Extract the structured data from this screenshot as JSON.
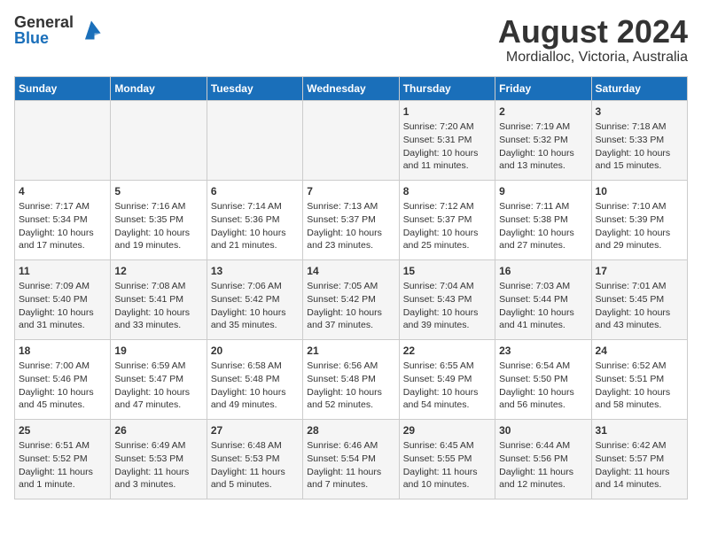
{
  "header": {
    "logo_general": "General",
    "logo_blue": "Blue",
    "title": "August 2024",
    "subtitle": "Mordialloc, Victoria, Australia"
  },
  "days_of_week": [
    "Sunday",
    "Monday",
    "Tuesday",
    "Wednesday",
    "Thursday",
    "Friday",
    "Saturday"
  ],
  "weeks": [
    [
      {
        "day": "",
        "content": ""
      },
      {
        "day": "",
        "content": ""
      },
      {
        "day": "",
        "content": ""
      },
      {
        "day": "",
        "content": ""
      },
      {
        "day": "1",
        "content": "Sunrise: 7:20 AM\nSunset: 5:31 PM\nDaylight: 10 hours\nand 11 minutes."
      },
      {
        "day": "2",
        "content": "Sunrise: 7:19 AM\nSunset: 5:32 PM\nDaylight: 10 hours\nand 13 minutes."
      },
      {
        "day": "3",
        "content": "Sunrise: 7:18 AM\nSunset: 5:33 PM\nDaylight: 10 hours\nand 15 minutes."
      }
    ],
    [
      {
        "day": "4",
        "content": "Sunrise: 7:17 AM\nSunset: 5:34 PM\nDaylight: 10 hours\nand 17 minutes."
      },
      {
        "day": "5",
        "content": "Sunrise: 7:16 AM\nSunset: 5:35 PM\nDaylight: 10 hours\nand 19 minutes."
      },
      {
        "day": "6",
        "content": "Sunrise: 7:14 AM\nSunset: 5:36 PM\nDaylight: 10 hours\nand 21 minutes."
      },
      {
        "day": "7",
        "content": "Sunrise: 7:13 AM\nSunset: 5:37 PM\nDaylight: 10 hours\nand 23 minutes."
      },
      {
        "day": "8",
        "content": "Sunrise: 7:12 AM\nSunset: 5:37 PM\nDaylight: 10 hours\nand 25 minutes."
      },
      {
        "day": "9",
        "content": "Sunrise: 7:11 AM\nSunset: 5:38 PM\nDaylight: 10 hours\nand 27 minutes."
      },
      {
        "day": "10",
        "content": "Sunrise: 7:10 AM\nSunset: 5:39 PM\nDaylight: 10 hours\nand 29 minutes."
      }
    ],
    [
      {
        "day": "11",
        "content": "Sunrise: 7:09 AM\nSunset: 5:40 PM\nDaylight: 10 hours\nand 31 minutes."
      },
      {
        "day": "12",
        "content": "Sunrise: 7:08 AM\nSunset: 5:41 PM\nDaylight: 10 hours\nand 33 minutes."
      },
      {
        "day": "13",
        "content": "Sunrise: 7:06 AM\nSunset: 5:42 PM\nDaylight: 10 hours\nand 35 minutes."
      },
      {
        "day": "14",
        "content": "Sunrise: 7:05 AM\nSunset: 5:42 PM\nDaylight: 10 hours\nand 37 minutes."
      },
      {
        "day": "15",
        "content": "Sunrise: 7:04 AM\nSunset: 5:43 PM\nDaylight: 10 hours\nand 39 minutes."
      },
      {
        "day": "16",
        "content": "Sunrise: 7:03 AM\nSunset: 5:44 PM\nDaylight: 10 hours\nand 41 minutes."
      },
      {
        "day": "17",
        "content": "Sunrise: 7:01 AM\nSunset: 5:45 PM\nDaylight: 10 hours\nand 43 minutes."
      }
    ],
    [
      {
        "day": "18",
        "content": "Sunrise: 7:00 AM\nSunset: 5:46 PM\nDaylight: 10 hours\nand 45 minutes."
      },
      {
        "day": "19",
        "content": "Sunrise: 6:59 AM\nSunset: 5:47 PM\nDaylight: 10 hours\nand 47 minutes."
      },
      {
        "day": "20",
        "content": "Sunrise: 6:58 AM\nSunset: 5:48 PM\nDaylight: 10 hours\nand 49 minutes."
      },
      {
        "day": "21",
        "content": "Sunrise: 6:56 AM\nSunset: 5:48 PM\nDaylight: 10 hours\nand 52 minutes."
      },
      {
        "day": "22",
        "content": "Sunrise: 6:55 AM\nSunset: 5:49 PM\nDaylight: 10 hours\nand 54 minutes."
      },
      {
        "day": "23",
        "content": "Sunrise: 6:54 AM\nSunset: 5:50 PM\nDaylight: 10 hours\nand 56 minutes."
      },
      {
        "day": "24",
        "content": "Sunrise: 6:52 AM\nSunset: 5:51 PM\nDaylight: 10 hours\nand 58 minutes."
      }
    ],
    [
      {
        "day": "25",
        "content": "Sunrise: 6:51 AM\nSunset: 5:52 PM\nDaylight: 11 hours\nand 1 minute."
      },
      {
        "day": "26",
        "content": "Sunrise: 6:49 AM\nSunset: 5:53 PM\nDaylight: 11 hours\nand 3 minutes."
      },
      {
        "day": "27",
        "content": "Sunrise: 6:48 AM\nSunset: 5:53 PM\nDaylight: 11 hours\nand 5 minutes."
      },
      {
        "day": "28",
        "content": "Sunrise: 6:46 AM\nSunset: 5:54 PM\nDaylight: 11 hours\nand 7 minutes."
      },
      {
        "day": "29",
        "content": "Sunrise: 6:45 AM\nSunset: 5:55 PM\nDaylight: 11 hours\nand 10 minutes."
      },
      {
        "day": "30",
        "content": "Sunrise: 6:44 AM\nSunset: 5:56 PM\nDaylight: 11 hours\nand 12 minutes."
      },
      {
        "day": "31",
        "content": "Sunrise: 6:42 AM\nSunset: 5:57 PM\nDaylight: 11 hours\nand 14 minutes."
      }
    ]
  ]
}
